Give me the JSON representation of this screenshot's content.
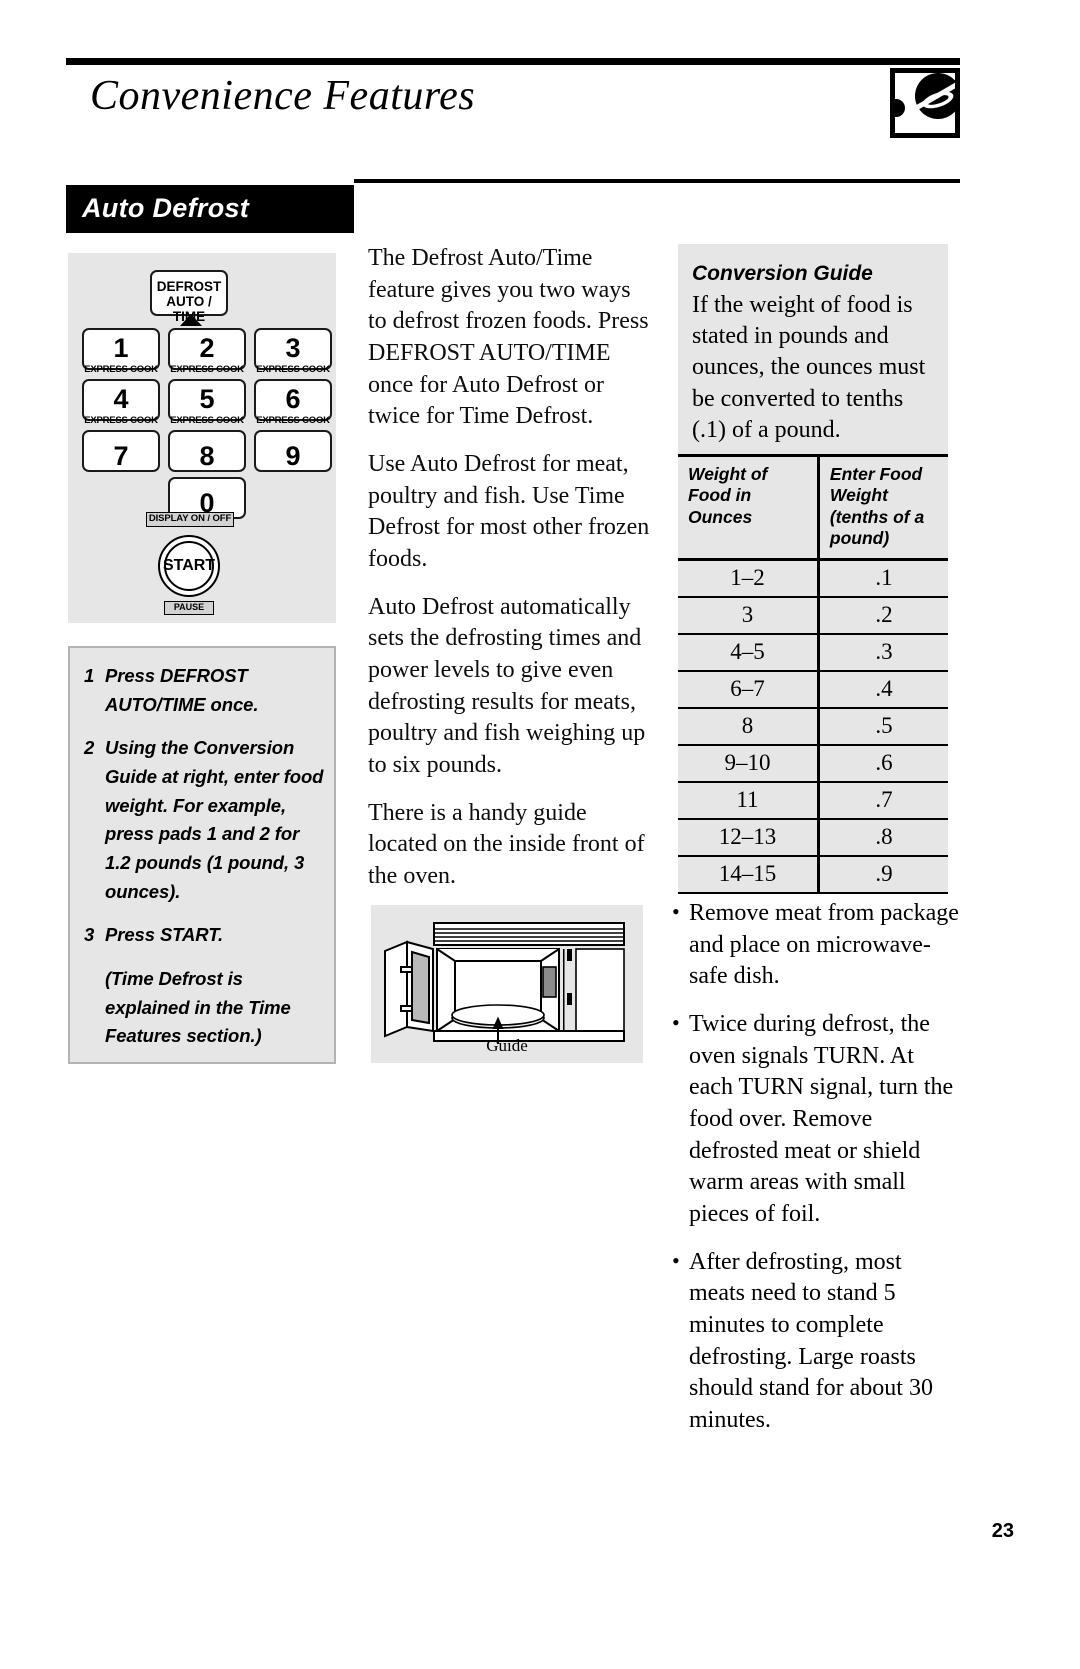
{
  "header": {
    "title": "Convenience Features",
    "badge_icon": "microwave-circle-icon"
  },
  "section": {
    "label": "Auto Defrost"
  },
  "keypad": {
    "defrost_button": {
      "line1": "DEFROST",
      "line2": "AUTO / TIME"
    },
    "keys": [
      {
        "num": "1",
        "sub": "EXPRESS COOK"
      },
      {
        "num": "2",
        "sub": "EXPRESS COOK"
      },
      {
        "num": "3",
        "sub": "EXPRESS COOK"
      },
      {
        "num": "4",
        "sub": "EXPRESS COOK"
      },
      {
        "num": "5",
        "sub": "EXPRESS COOK"
      },
      {
        "num": "6",
        "sub": "EXPRESS COOK"
      },
      {
        "num": "7",
        "sub": ""
      },
      {
        "num": "8",
        "sub": ""
      },
      {
        "num": "9",
        "sub": ""
      },
      {
        "num": "0",
        "sub": ""
      }
    ],
    "display_label": "DISPLAY ON / OFF",
    "start_label": "START",
    "pause_label": "PAUSE"
  },
  "steps": [
    {
      "number": "1",
      "text": "Press DEFROST AUTO/TIME once."
    },
    {
      "number": "2",
      "text": "Using the Conversion Guide at right, enter food weight. For example, press pads 1 and 2 for 1.2 pounds (1 pound, 3 ounces)."
    },
    {
      "number": "3",
      "text": "Press START."
    },
    {
      "number": "",
      "text": "(Time Defrost is explained in the Time Features section.)"
    }
  ],
  "main_text": [
    "The Defrost Auto/Time feature gives you two ways to defrost frozen foods. Press DEFROST AUTO/TIME once for Auto Defrost or twice for Time Defrost.",
    "Use Auto Defrost for meat, poultry and fish. Use Time Defrost for most other frozen foods.",
    "Auto Defrost automatically sets the defrosting times and power levels to give even defrosting results for meats, poultry and fish weighing up to six pounds.",
    "There is a handy guide located on the inside front of the oven."
  ],
  "figure": {
    "caption": "Guide",
    "icon": "microwave-oven-icon"
  },
  "conversion_guide": {
    "title": "Conversion Guide",
    "intro": "If the weight of food is stated in pounds and ounces, the ounces must be converted to tenths (.1) of a pound.",
    "columns": [
      "Weight of Food in Ounces",
      "Enter Food Weight (tenths of a pound)"
    ],
    "rows": [
      [
        "1–2",
        ".1"
      ],
      [
        "3",
        ".2"
      ],
      [
        "4–5",
        ".3"
      ],
      [
        "6–7",
        ".4"
      ],
      [
        "8",
        ".5"
      ],
      [
        "9–10",
        ".6"
      ],
      [
        "11",
        ".7"
      ],
      [
        "12–13",
        ".8"
      ],
      [
        "14–15",
        ".9"
      ]
    ]
  },
  "tips": [
    "Remove meat from package and place on microwave-safe dish.",
    "Twice during defrost, the oven signals TURN. At each TURN signal, turn the food over. Remove defrosted meat or shield warm areas with small pieces of foil.",
    "After defrosting, most meats need to stand 5 minutes to complete defrosting. Large roasts should stand for about 30 minutes."
  ],
  "bullet_char": "•",
  "page_number": "23"
}
